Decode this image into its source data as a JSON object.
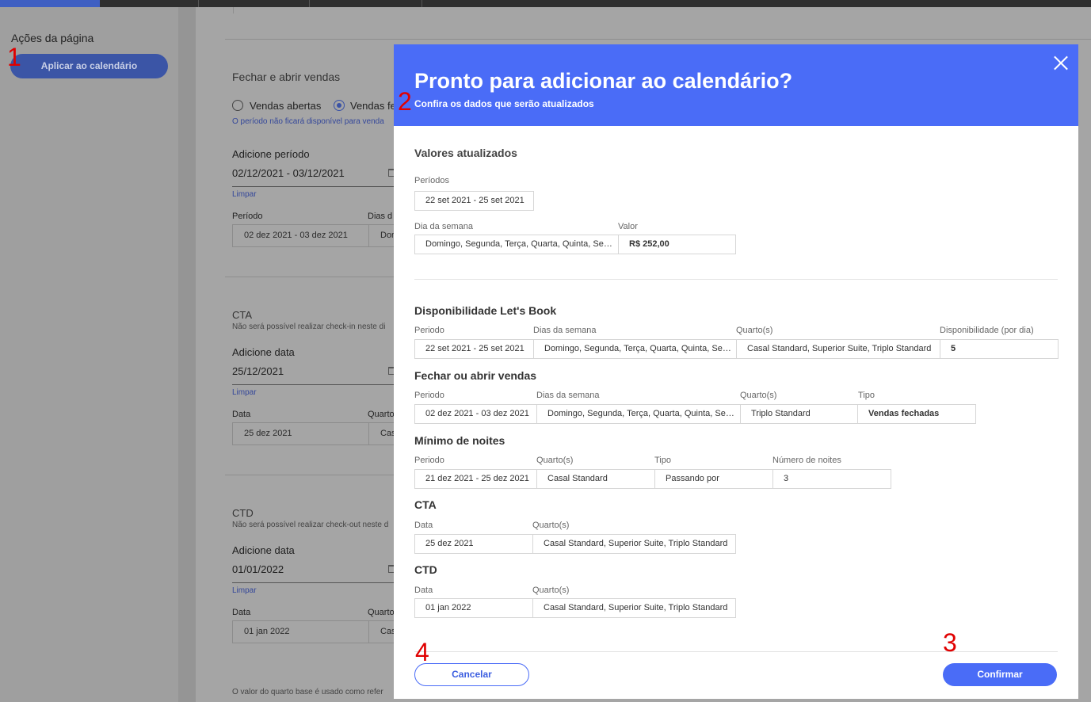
{
  "background": {
    "sidebar": {
      "title": "Ações da página",
      "apply_button": "Aplicar ao calendário"
    },
    "sales_section": {
      "title": "Fechar e abrir vendas",
      "radio_open": "Vendas abertas",
      "radio_closed": "Vendas fe",
      "selected": "Vendas fechadas",
      "note": "O período não ficará disponível para venda",
      "add_label": "Adicione período",
      "add_value": "02/12/2021 - 03/12/2021",
      "clear": "Limpar",
      "col_period": "Período",
      "col_days": "Dias d",
      "period_value": "02 dez 2021 - 03 dez 2021",
      "days_value": "Dor"
    },
    "cta_section": {
      "title": "CTA",
      "note": "Não será possível realizar check-in neste di",
      "add_label": "Adicione data",
      "add_value": "25/12/2021",
      "clear": "Limpar",
      "col_date": "Data",
      "col_room": "Quarto",
      "date_value": "25 dez 2021",
      "room_value": "Cas"
    },
    "ctd_section": {
      "title": "CTD",
      "note": "Não será possível realizar check-out neste d",
      "add_label": "Adicione data",
      "add_value": "01/01/2022",
      "clear": "Limpar",
      "col_date": "Data",
      "col_room": "Quarto",
      "date_value": "01 jan 2022",
      "room_value": "Cas"
    },
    "footer_note": "O valor do quarto base é usado como refer"
  },
  "markers": [
    "1",
    "2",
    "3",
    "4"
  ],
  "modal": {
    "title": "Pronto para adicionar ao calendário?",
    "subtitle": "Confira os dados que serão atualizados",
    "updated_values": {
      "heading": "Valores atualizados",
      "periods_label": "Períodos",
      "period": "22 set 2021 - 25 set 2021",
      "weekday_label": "Dia da semana",
      "value_label": "Valor",
      "weekdays": "Domingo, Segunda, Terça, Quarta, Quinta, Sexta",
      "value": "R$ 252,00"
    },
    "availability": {
      "heading": "Disponibilidade Let's Book",
      "col_period": "Periodo",
      "col_days": "Dias da semana",
      "col_rooms": "Quarto(s)",
      "col_avail": "Disponibilidade (por dia)",
      "period": "22 set 2021 - 25 set 2021",
      "days": "Domingo, Segunda, Terça, Quarta, Quinta, Sexta",
      "rooms": "Casal Standard, Superior Suite, Triplo Standard",
      "avail": "5"
    },
    "sales": {
      "heading": "Fechar ou abrir vendas",
      "col_period": "Periodo",
      "col_days": "Dias da semana",
      "col_rooms": "Quarto(s)",
      "col_type": "Tipo",
      "period": "02 dez 2021 - 03 dez 2021",
      "days": "Domingo, Segunda, Terça, Quarta, Quinta, Sexta",
      "rooms": "Triplo Standard",
      "type": "Vendas fechadas"
    },
    "min_nights": {
      "heading": "Mínimo de noites",
      "col_period": "Periodo",
      "col_rooms": "Quarto(s)",
      "col_type": "Tipo",
      "col_nights": "Número de noites",
      "period": "21 dez 2021 - 25 dez 2021",
      "rooms": "Casal Standard",
      "type": "Passando por",
      "nights": "3"
    },
    "cta": {
      "heading": "CTA",
      "col_date": "Data",
      "col_rooms": "Quarto(s)",
      "date": "25 dez 2021",
      "rooms": "Casal Standard, Superior Suite, Triplo Standard"
    },
    "ctd": {
      "heading": "CTD",
      "col_date": "Data",
      "col_rooms": "Quarto(s)",
      "date": "01 jan 2022",
      "rooms": "Casal Standard, Superior Suite, Triplo Standard"
    },
    "cancel_button": "Cancelar",
    "confirm_button": "Confirmar"
  }
}
